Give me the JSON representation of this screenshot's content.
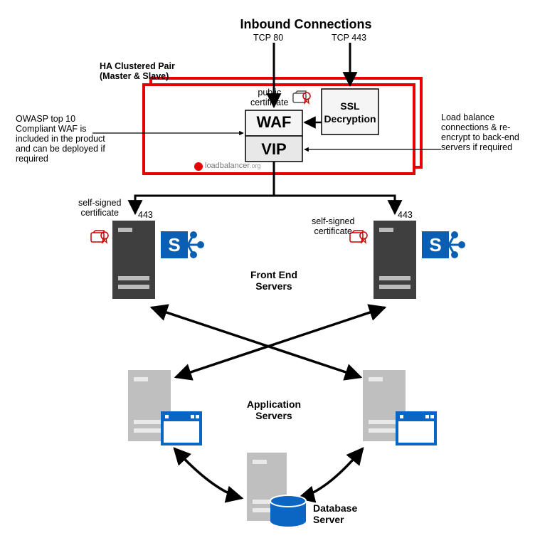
{
  "title": "Inbound Connections",
  "ports": {
    "tcp80": "TCP 80",
    "tcp443": "TCP 443"
  },
  "ha": {
    "label": "HA Clustered Pair\n(Master & Slave)"
  },
  "pubcert": "public\ncertificate",
  "waf": "WAF",
  "vip": "VIP",
  "ssl": "SSL\nDecryption",
  "brand": "loadbalancer",
  "note_left": "OWASP top 10 Compliant WAF is included in the product and can be deployed if required",
  "note_right": "Load balance connections & re-encrypt to back-end servers if required",
  "selfcert": "self-signed\ncertificate",
  "p443a": "443",
  "p443b": "443",
  "frontend": "Front End\nServers",
  "appservers": "Application\nServers",
  "dbserver": "Database\nServer"
}
